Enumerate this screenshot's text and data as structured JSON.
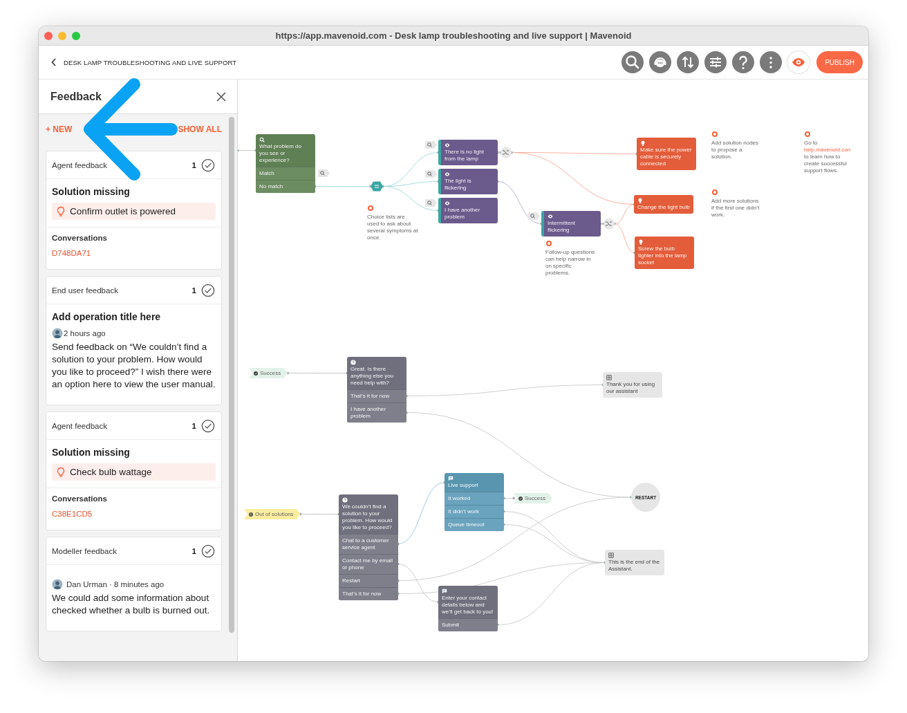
{
  "window": {
    "title": "https://app.mavenoid.com - Desk lamp troubleshooting and live support | Mavenoid"
  },
  "header": {
    "title": "DESK LAMP TROUBLESHOOTING AND LIVE SUPPORT",
    "toolbar": [
      {
        "kind": "search"
      },
      {
        "kind": "support"
      },
      {
        "kind": "sort"
      },
      {
        "kind": "settings"
      },
      {
        "kind": "help"
      },
      {
        "kind": "more"
      },
      {
        "kind": "preview"
      }
    ],
    "publish": "PUBLISH"
  },
  "feedback": {
    "title": "Feedback",
    "new": "+ NEW",
    "show_all": "SHOW ALL",
    "cards": [
      {
        "kind": "solution",
        "type": "Agent feedback",
        "count": "1",
        "title": "Solution missing",
        "suggestion": "Confirm outlet is powered",
        "conversations_label": "Conversations",
        "conversation": "D748DA71"
      },
      {
        "kind": "comment",
        "type": "End user feedback",
        "count": "1",
        "title": "Add operation title here",
        "meta": "2 hours ago",
        "text": "Send feedback on “We couldn’t find a solution to your problem. How would you like to proceed?” I wish there were an option here to view the user manual."
      },
      {
        "kind": "solution",
        "type": "Agent feedback",
        "count": "1",
        "title": "Solution missing",
        "suggestion": "Check bulb wattage",
        "conversations_label": "Conversations",
        "conversation": "C38E1CD5"
      },
      {
        "kind": "comment",
        "type": "Modeller feedback",
        "count": "1",
        "meta": "Dan Urman · 8 minutes ago",
        "text": "We could add some information about checked whether a bulb is burned out."
      }
    ]
  },
  "canvas": {
    "nodes": [
      {
        "kind": "symptom_question",
        "text": "What problem do you see or experience?",
        "options": [
          "Match",
          "No match"
        ]
      },
      {
        "kind": "symptom",
        "text": "There is no light from the lamp"
      },
      {
        "kind": "symptom",
        "text": "The light is flickering"
      },
      {
        "kind": "symptom",
        "text": "I have another problem"
      },
      {
        "kind": "symptom",
        "text": "Intermittent flickering"
      },
      {
        "kind": "solution",
        "text": "Make sure the power cable is securely connected"
      },
      {
        "kind": "solution",
        "text": "Change the light bulb"
      },
      {
        "kind": "solution",
        "text": "Screw the bulb tighter into the lamp socket"
      },
      {
        "kind": "question",
        "text": "Great. Is there anything else you need help with?",
        "options": [
          "That’s it for now",
          "I have another problem"
        ]
      },
      {
        "kind": "message",
        "text": "Thank you for using our assistant"
      },
      {
        "kind": "restart",
        "text": "RESTART"
      },
      {
        "kind": "question",
        "text": "We couldn’t find a solution to your problem. How would you like to proceed?",
        "options": [
          "Chat to a customer service agent",
          "Contact me by email or phone",
          "Restart",
          "That’s it for now"
        ]
      },
      {
        "kind": "live_support",
        "text": "Live support",
        "options": [
          "It worked",
          "It didn’t work",
          "Queue timeout"
        ]
      },
      {
        "kind": "message",
        "text": "This is the end of the Assistant."
      },
      {
        "kind": "form",
        "text": "Enter your contact details below and we’ll get back to you!",
        "options": [
          "Submit"
        ]
      },
      {
        "kind": "success_tag",
        "text": "Success"
      },
      {
        "kind": "fallback_tag",
        "text": "Out of solutions"
      },
      {
        "kind": "success_tag",
        "text": "Success"
      }
    ],
    "notes": [
      {
        "text": "Choice lists are used to ask about several symptoms at once."
      },
      {
        "text": "Follow-up questions can help narrow in on specific problems."
      },
      {
        "text": "Add solution nodes to propose a solution."
      },
      {
        "text": "Add more solutions if the first one didn’t work."
      },
      {
        "text": "Go to",
        "link": "help.mavenoid.con",
        "text_after": "to learn how to create successful support flows."
      }
    ]
  }
}
